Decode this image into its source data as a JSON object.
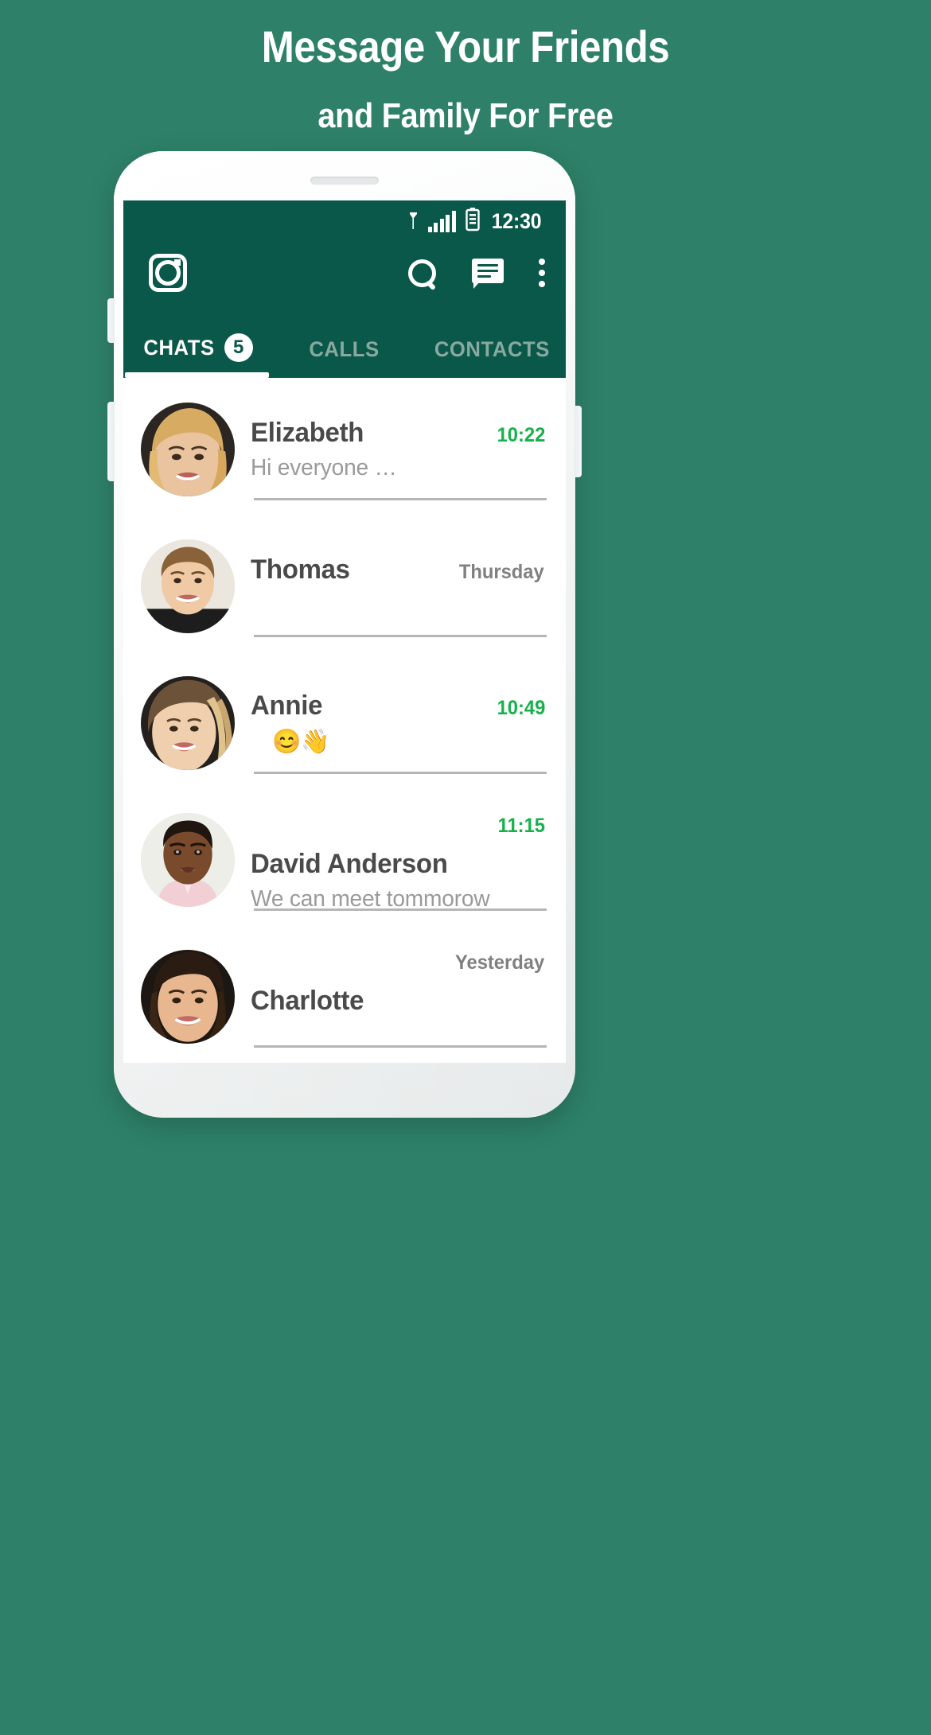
{
  "promo": {
    "line1": "Message Your Friends",
    "line2": "and Family For Free"
  },
  "colors": {
    "page_background": "#2E8168",
    "app_header": "#0A5849",
    "accent_time": "#16B14B",
    "muted_text": "#9A9A9A",
    "name_text": "#4A4A4A",
    "tab_inactive": "#89A9A0"
  },
  "status_bar": {
    "signal_icon": "signal-bars-icon",
    "network_icon": "antenna-icon",
    "battery_icon": "battery-icon",
    "time": "12:30"
  },
  "app_bar": {
    "camera_icon": "camera-icon",
    "search_icon": "search-icon",
    "chat_icon": "chat-bubble-icon",
    "overflow_icon": "more-vertical-icon"
  },
  "tabs": [
    {
      "label": "CHATS",
      "badge": "5",
      "active": true
    },
    {
      "label": "CALLS",
      "badge": "",
      "active": false
    },
    {
      "label": "CONTACTS",
      "badge": "",
      "active": false
    }
  ],
  "chats": [
    {
      "name": "Elizabeth",
      "message": "Hi everyone …",
      "time": "10:22",
      "time_is_accent": true,
      "layout": "inline"
    },
    {
      "name": "Thomas",
      "message": "",
      "time": "Thursday",
      "time_is_accent": false,
      "layout": "inline"
    },
    {
      "name": "Annie",
      "message": "😊👋",
      "time": "10:49",
      "time_is_accent": true,
      "layout": "inline"
    },
    {
      "name": "David Anderson",
      "message": "We can meet tommorow",
      "time": "11:15",
      "time_is_accent": true,
      "layout": "time-above"
    },
    {
      "name": "Charlotte",
      "message": "",
      "time": "Yesterday",
      "time_is_accent": false,
      "layout": "time-above"
    }
  ]
}
